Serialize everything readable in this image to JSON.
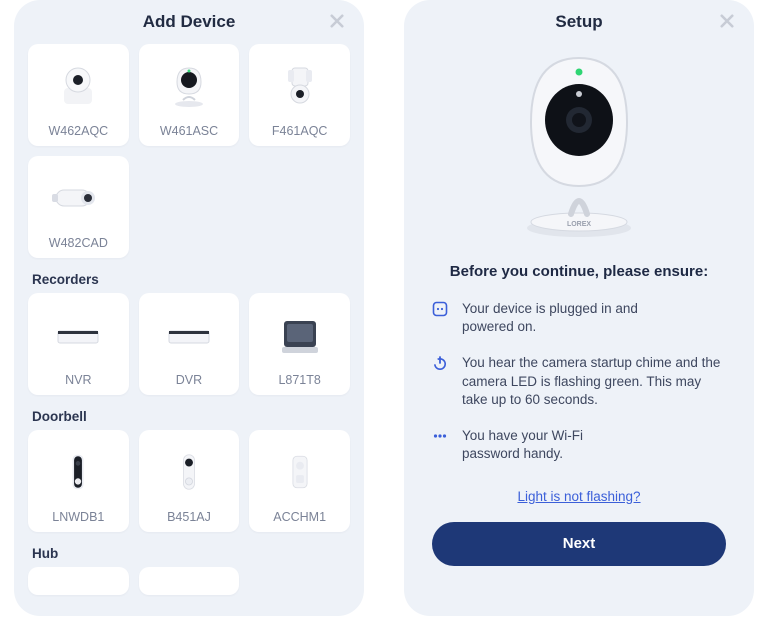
{
  "left": {
    "title": "Add Device",
    "sections": [
      {
        "title": null,
        "items": [
          {
            "label": "W462AQC",
            "icon": "pt-camera"
          },
          {
            "label": "W461ASC",
            "icon": "indoor-camera"
          },
          {
            "label": "F461AQC",
            "icon": "floodlight-camera"
          },
          {
            "label": "W482CAD",
            "icon": "bullet-camera"
          }
        ]
      },
      {
        "title": "Recorders",
        "items": [
          {
            "label": "NVR",
            "icon": "nvr"
          },
          {
            "label": "DVR",
            "icon": "dvr"
          },
          {
            "label": "L871T8",
            "icon": "monitor-recorder"
          }
        ]
      },
      {
        "title": "Doorbell",
        "items": [
          {
            "label": "LNWDB1",
            "icon": "doorbell-black"
          },
          {
            "label": "B451AJ",
            "icon": "doorbell-white"
          },
          {
            "label": "ACCHM1",
            "icon": "chime"
          }
        ]
      },
      {
        "title": "Hub",
        "items": []
      }
    ]
  },
  "right": {
    "title": "Setup",
    "heroIcon": "indoor-camera-large",
    "ensureTitle": "Before you continue, please ensure:",
    "checks": [
      {
        "icon": "plug-icon",
        "text": "Your device is plugged in and powered on."
      },
      {
        "icon": "power-icon",
        "text": "You hear the camera startup chime and the camera LED is flashing green. This may take up to 60 seconds."
      },
      {
        "icon": "dots-icon",
        "text": "You have your Wi-Fi password handy."
      }
    ],
    "helpLink": "Light is not flashing?",
    "nextLabel": "Next"
  }
}
